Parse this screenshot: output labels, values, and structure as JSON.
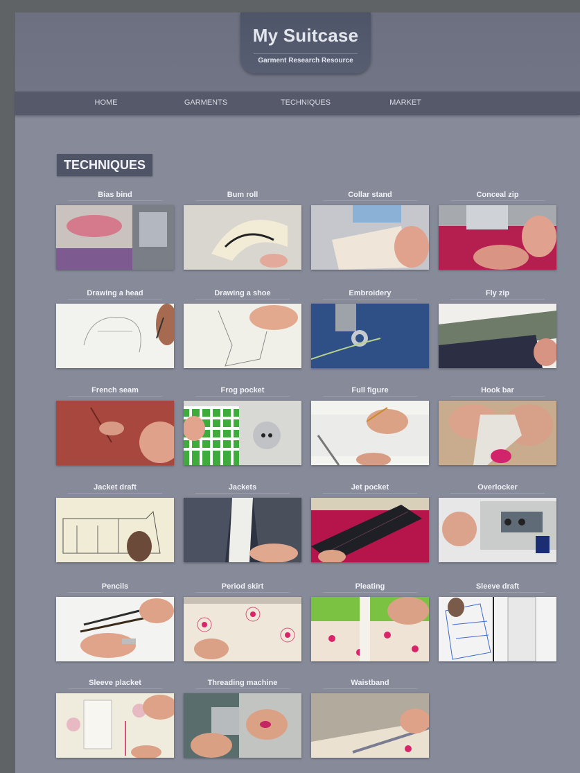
{
  "site": {
    "title": "My Suitcase",
    "subtitle": "Garment Research Resource"
  },
  "nav": {
    "items": [
      "HOME",
      "GARMENTS",
      "TECHNIQUES",
      "MARKET"
    ]
  },
  "section": {
    "title": "TECHNIQUES"
  },
  "techniques": [
    {
      "label": "Bias bind"
    },
    {
      "label": "Bum roll"
    },
    {
      "label": "Collar stand"
    },
    {
      "label": "Conceal zip"
    },
    {
      "label": "Drawing a head"
    },
    {
      "label": "Drawing a shoe"
    },
    {
      "label": "Embroidery"
    },
    {
      "label": "Fly zip"
    },
    {
      "label": "French seam"
    },
    {
      "label": "Frog pocket"
    },
    {
      "label": "Full figure"
    },
    {
      "label": "Hook bar"
    },
    {
      "label": "Jacket draft"
    },
    {
      "label": "Jackets"
    },
    {
      "label": "Jet pocket"
    },
    {
      "label": "Overlocker"
    },
    {
      "label": "Pencils"
    },
    {
      "label": "Period skirt"
    },
    {
      "label": "Pleating"
    },
    {
      "label": "Sleeve draft"
    },
    {
      "label": "Sleeve placket"
    },
    {
      "label": "Threading machine"
    },
    {
      "label": "Waistband"
    }
  ],
  "colors": {
    "page_bg": "#868a99",
    "header_bg": "#6c7080",
    "nav_bg": "#55596a",
    "logo_bg": "#4f5568"
  }
}
